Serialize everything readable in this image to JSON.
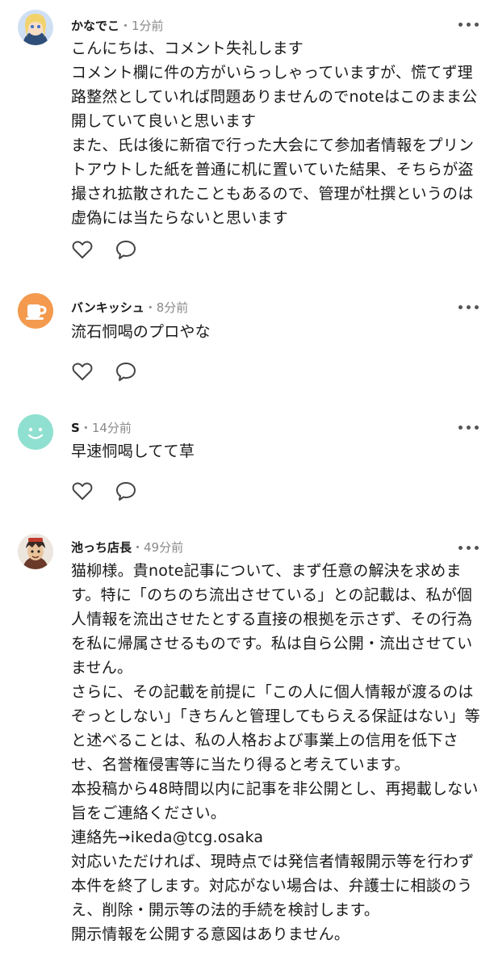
{
  "comments": [
    {
      "name": "かなでこ",
      "meta": "・1分前",
      "avatar": "anime-character-avatar",
      "text": "こんにちは、コメント失礼します\nコメント欄に件の方がいらっしゃっていますが、慌てず理路整然としていれば問題ありませんのでnoteはこのまま公開していて良いと思います\nまた、氏は後に新宿で行った大会にて参加者情報をプリントアウトした紙を普通に机に置いていた結果、そちらが盗撮され拡散されたこともあるので、管理が杜撰というのは虚偽には当たらないと思います"
    },
    {
      "name": "バンキッシュ",
      "meta": "・8分前",
      "avatar": "coffee-cup-avatar",
      "text": "流石恫喝のプロやな"
    },
    {
      "name": "S",
      "meta": "・14分前",
      "avatar": "default-smile-avatar",
      "text": "早速恫喝してて草"
    },
    {
      "name": "池っち店長",
      "meta": "・49分前",
      "avatar": "illustrated-character-avatar",
      "text": "猫柳様。貴note記事について、まず任意の解決を求めます。特に「のちのち流出させている」との記載は、私が個人情報を流出させたとする直接の根拠を示さず、その行為を私に帰属させるものです。私は自ら公開・流出させていません。\nさらに、その記載を前提に「この人に個人情報が渡るのはぞっとしない」「きちんと管理してもらえる保証はない」等と述べることは、私の人格および事業上の信用を低下させ、名誉権侵害等に当たり得ると考えています。\n本投稿から48時間以内に記事を非公開とし、再掲載しない旨をご連絡ください。\n連絡先→ikeda@tcg.osaka\n対応いただければ、現時点では発信者情報開示等を行わず本件を終了します。対応がない場合は、弁護士に相談のうえ、削除・開示等の法的手続を検討します。\n開示情報を公開する意図はありません。"
    }
  ],
  "icons": {
    "like": "heart-icon",
    "reply": "comment-bubble-icon",
    "more": "more-dots-icon"
  },
  "colors": {
    "text": "#1a1a1a",
    "meta": "#8a8a8a",
    "icon": "#444444",
    "coffee_avatar_bg": "#f39a4e",
    "default_avatar_bg": "#8fe0d0"
  }
}
